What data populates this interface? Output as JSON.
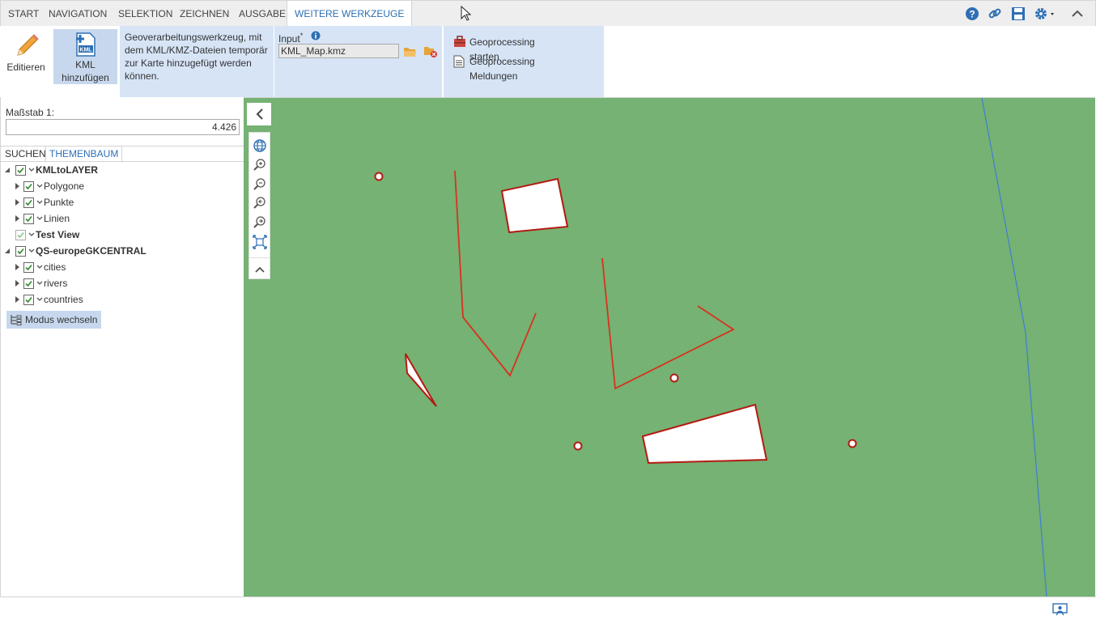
{
  "tabs": [
    {
      "label": "START",
      "active": false
    },
    {
      "label": "NAVIGATION",
      "active": false
    },
    {
      "label": "SELEKTION",
      "active": false
    },
    {
      "label": "ZEICHNEN",
      "active": false
    },
    {
      "label": "AUSGABE",
      "active": false
    },
    {
      "label": "WEITERE WERKZEUGE",
      "active": true
    }
  ],
  "toolbar_icons": [
    "help-icon",
    "link-icon",
    "save-icon",
    "settings-icon",
    "collapse-ribbon-icon"
  ],
  "ribbon": {
    "edit_label": "Editieren",
    "kml_label_1": "KML",
    "kml_label_2": "hinzufügen",
    "kml_icon_text": "KML",
    "description": "Geoverarbeitungswerkzeug, mit dem KML/KMZ-Dateien temporär zur Karte hinzugefügt werden können.",
    "input_label": "Input",
    "input_required": "*",
    "input_value": "KML_Map.kmz",
    "geo_start": "Geoprocessing starten",
    "geo_messages": "Geoprocessing Meldungen"
  },
  "left": {
    "scale_label": "Maßstab 1:",
    "scale_value": "4.426",
    "tab_search": "SUCHEN",
    "tab_tree": "THEMENBAUM",
    "mode_button": "Modus wechseln",
    "tree": [
      {
        "label": "KMLtoLAYER",
        "level": 0,
        "bold": true,
        "checked": true,
        "expanded": true
      },
      {
        "label": "Polygone",
        "level": 1,
        "bold": false,
        "checked": true,
        "expanded": false
      },
      {
        "label": "Punkte",
        "level": 1,
        "bold": false,
        "checked": true,
        "expanded": false
      },
      {
        "label": "Linien",
        "level": 1,
        "bold": false,
        "checked": true,
        "expanded": false
      },
      {
        "label": "Test View",
        "level": 0,
        "bold": true,
        "checked": true,
        "expanded": null
      },
      {
        "label": "QS-europeGKCENTRAL",
        "level": 0,
        "bold": true,
        "checked": true,
        "expanded": true
      },
      {
        "label": "cities",
        "level": 1,
        "bold": false,
        "checked": true,
        "expanded": false
      },
      {
        "label": "rivers",
        "level": 1,
        "bold": false,
        "checked": true,
        "expanded": false
      },
      {
        "label": "countries",
        "level": 1,
        "bold": false,
        "checked": true,
        "expanded": false
      }
    ]
  },
  "map": {
    "background": "#75b273",
    "feature_color": "#cc2a1e",
    "river_color": "#3d7fd6"
  }
}
